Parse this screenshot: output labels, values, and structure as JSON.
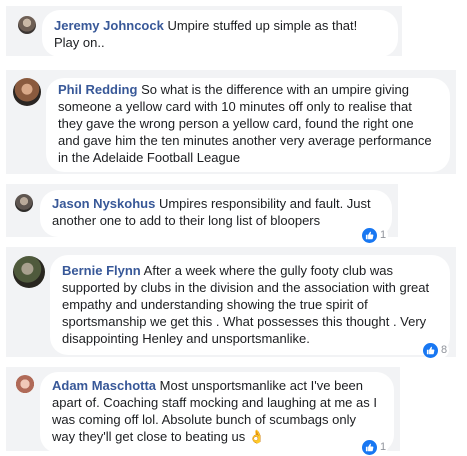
{
  "comments": [
    {
      "author": "Jeremy Johncock",
      "text": "Umpire stuffed up simple as that! Play on..",
      "avatar_icon": "user-avatar-icon"
    },
    {
      "author": "Phil Redding",
      "text": "So what is the difference with an umpire giving someone a yellow card with 10 minutes off only to realise that they gave the wrong person a yellow card, found the right one and gave him the ten minutes another very average performance in the Adelaide Football League",
      "avatar_icon": "user-avatar-icon"
    },
    {
      "author": "Jason Nyskohus",
      "text": "Umpires responsibility and fault. Just another one to add to their long list of bloopers",
      "avatar_icon": "user-avatar-icon",
      "reaction_count": "1"
    },
    {
      "author": "Bernie Flynn",
      "text": "After a week where the gully footy club was supported by clubs in the division and the association with great empathy and understanding showing the true spirit of sportsmanship we get this . What possesses this thought . Very disappointing Henley and unsportsmanlike.",
      "avatar_icon": "user-avatar-icon",
      "reaction_count": "8"
    },
    {
      "author": "Adam Maschotta",
      "text": "Most unsportsmanlike act I've been apart of. Coaching staff mocking and laughing at me as I was coming off lol. Absolute bunch of scumbags only way they'll get close to beating us",
      "emoji": "👌",
      "avatar_icon": "user-avatar-icon",
      "reaction_count": "1"
    }
  ],
  "reaction_icon": "like-thumbs-up-icon",
  "colors": {
    "name": "#385898",
    "strip": "#f2f3f5",
    "like": "#1877f2"
  }
}
